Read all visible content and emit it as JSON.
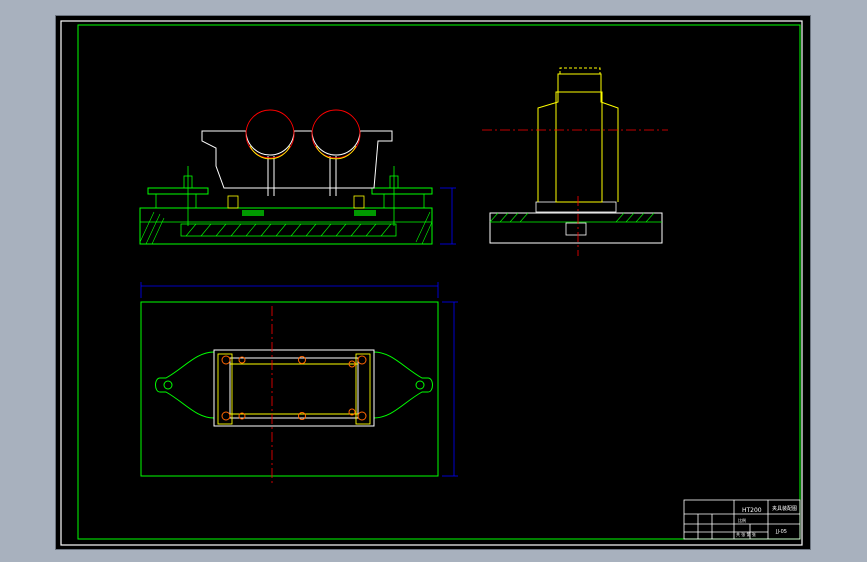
{
  "drawing": {
    "colors": {
      "background": "#000000",
      "border": "#ffffff",
      "frame": "#00ff00",
      "part": "#00ff00",
      "body_outline": "#ffffff",
      "housing": "#ffff00",
      "centerline": "#ff0000",
      "dimension": "#0000ff",
      "hatch": "#00ff00"
    },
    "views": {
      "front_view": {
        "name": "front-section-view"
      },
      "side_view": {
        "name": "side-view"
      },
      "top_view": {
        "name": "top-plan-view"
      }
    },
    "title_block": {
      "part_code": "HT200",
      "drawing_title": "夹具装配图",
      "drawing_number": "JJ-05",
      "scale_label": "比例",
      "sheet_label": "共 张 第 张"
    }
  }
}
